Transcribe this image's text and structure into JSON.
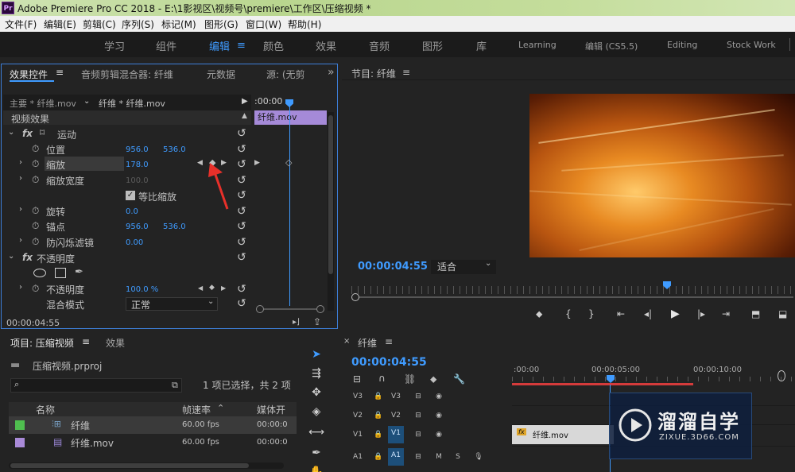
{
  "window": {
    "title": "Adobe Premiere Pro CC 2018 - E:\\1影视区\\视频号\\premiere\\工作区\\压缩视频 *",
    "logo": "Pr"
  },
  "menu": [
    "文件(F)",
    "编辑(E)",
    "剪辑(C)",
    "序列(S)",
    "标记(M)",
    "图形(G)",
    "窗口(W)",
    "帮助(H)"
  ],
  "workspaces": {
    "items": [
      "学习",
      "组件",
      "编辑",
      "颜色",
      "效果",
      "音频",
      "图形",
      "库",
      "Learning",
      "编辑 (CS5.5)",
      "Editing",
      "Stock Work"
    ],
    "active": "编辑",
    "menu_icon": "≡"
  },
  "effect_controls": {
    "tabs": [
      "效果控件",
      "音频剪辑混合器: 纤维",
      "元数据",
      "源: (无剪"
    ],
    "active_tab": "效果控件",
    "expand_icon": "»",
    "master_label": "主要 * 纤维.mov",
    "sequence_clip": "纤维 * 纤维.mov",
    "timecode_ruler": ":00:00",
    "clip_name": "纤维.mov",
    "section_video": "视频效果",
    "motion_label": "运动",
    "fx_label": "fx",
    "properties": {
      "position": {
        "label": "位置",
        "x": "956.0",
        "y": "536.0"
      },
      "scale": {
        "label": "缩放",
        "value": "178.0"
      },
      "scale_width": {
        "label": "缩放宽度",
        "value": "100.0"
      },
      "uniform_scale": {
        "label": "等比缩放",
        "checked": true
      },
      "rotation": {
        "label": "旋转",
        "value": "0.0"
      },
      "anchor": {
        "label": "锚点",
        "x": "956.0",
        "y": "536.0"
      },
      "anti_flicker": {
        "label": "防闪烁滤镜",
        "value": "0.00"
      },
      "opacity_section": "不透明度",
      "opacity": {
        "label": "不透明度",
        "value": "100.0 %"
      },
      "blend_mode": {
        "label": "混合模式",
        "value": "正常"
      }
    },
    "current_time": "00:00:04:55"
  },
  "program_monitor": {
    "title": "节目: 纤维",
    "timecode": "00:00:04:55",
    "fit_label": "适合"
  },
  "project": {
    "tabs": [
      "项目: 压缩视频",
      "效果"
    ],
    "active_tab": "项目: 压缩视频",
    "file_name": "压缩视频.prproj",
    "selection_info": "1 项已选择，共 2 项",
    "columns": [
      "名称",
      "帧速率",
      "媒体开"
    ],
    "items": [
      {
        "name": "纤维",
        "fps": "60.00 fps",
        "start": "00:00:0",
        "color": "#4fbe4f",
        "type": "sequence"
      },
      {
        "name": "纤维.mov",
        "fps": "60.00 fps",
        "start": "00:00:0",
        "color": "#a98ad8",
        "type": "clip"
      }
    ]
  },
  "timeline": {
    "tab": "纤维",
    "timecode": "00:00:04:55",
    "ruler": [
      ":00:00",
      "00:00:05:00",
      "00:00:10:00"
    ],
    "tracks": [
      {
        "name": "V3",
        "target": "V3",
        "kind": "video"
      },
      {
        "name": "V2",
        "target": "V2",
        "kind": "video"
      },
      {
        "name": "V1",
        "target": "V1",
        "kind": "video",
        "active": true
      },
      {
        "name": "A1",
        "target": "A1",
        "kind": "audio",
        "active": true
      }
    ],
    "clip_name": "纤维.mov",
    "audio_labels": {
      "mute": "M",
      "solo": "S"
    }
  },
  "watermark": {
    "title": "溜溜自学",
    "url": "ZIXUE.3D66.COM"
  },
  "colors": {
    "accent": "#3f9bff",
    "clip_purple": "#a58ad8",
    "panel_border": "#3d7fd9",
    "arrow_red": "#e8302a"
  }
}
